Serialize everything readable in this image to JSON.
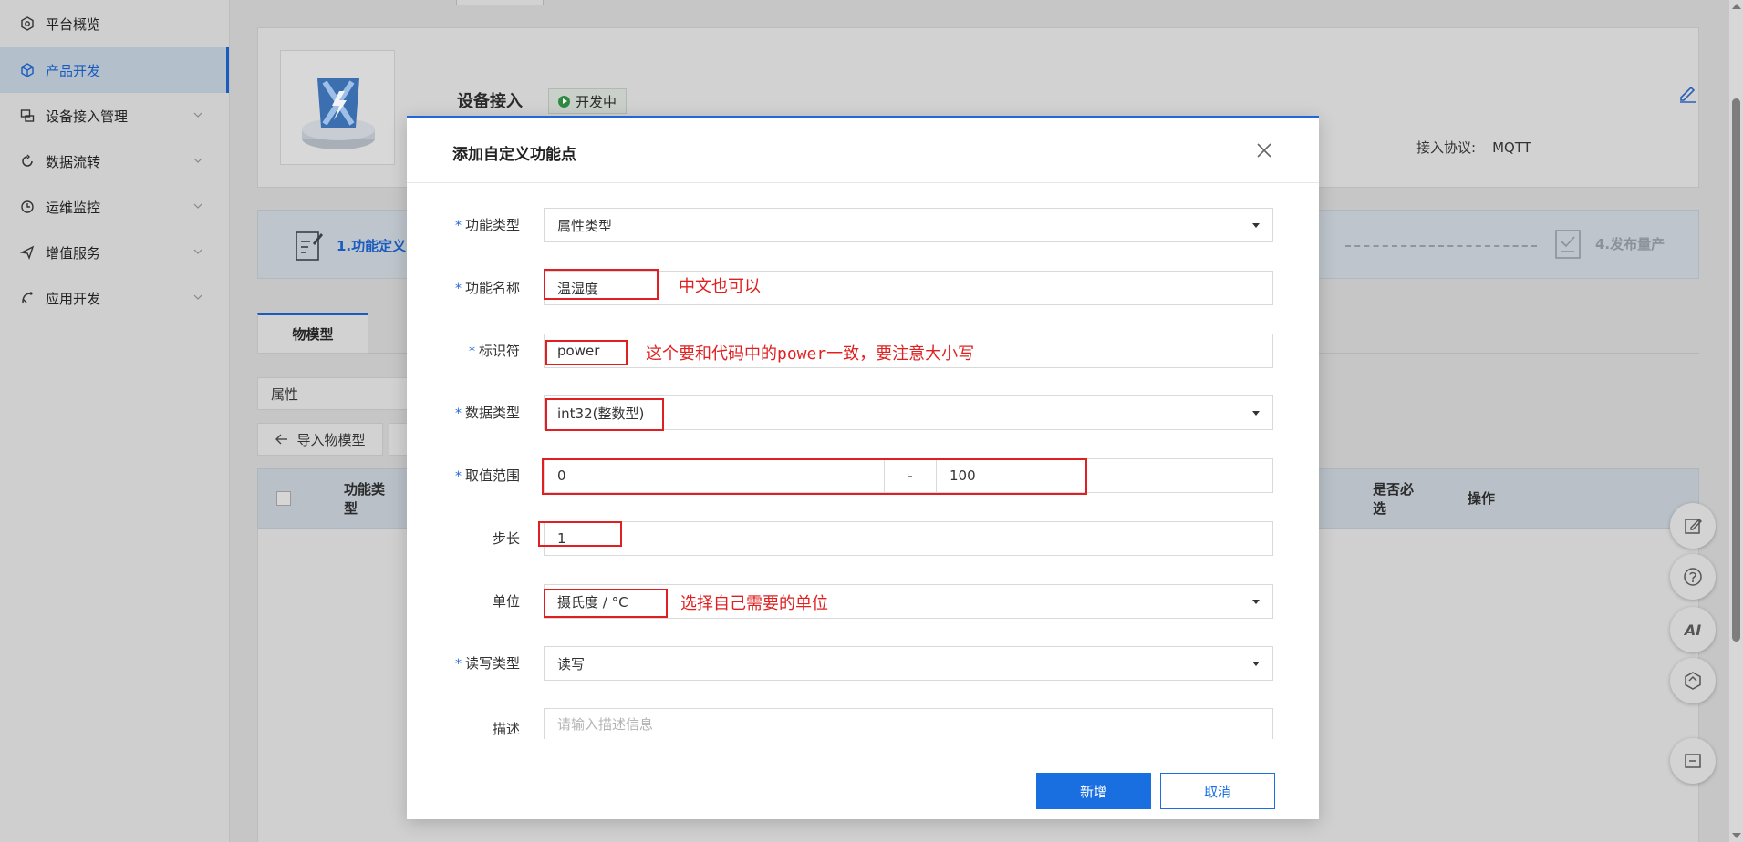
{
  "sidebar": {
    "items": [
      {
        "label": "平台概览",
        "icon": "platform-icon"
      },
      {
        "label": "产品开发",
        "icon": "cube-icon",
        "active": true
      },
      {
        "label": "设备接入管理",
        "icon": "device-icon"
      },
      {
        "label": "数据流转",
        "icon": "flow-icon"
      },
      {
        "label": "运维监控",
        "icon": "monitor-icon"
      },
      {
        "label": "增值服务",
        "icon": "service-icon"
      },
      {
        "label": "应用开发",
        "icon": "app-icon"
      }
    ]
  },
  "product": {
    "title": "设备接入",
    "status": "开发中",
    "protocol_label": "接入协议:",
    "protocol_value": "MQTT"
  },
  "steps": {
    "step1": "1.功能定义",
    "step4": "4.发布量产"
  },
  "tabs": {
    "model": "物模型"
  },
  "filter": {
    "type_select": "属性"
  },
  "toolbar": {
    "import_label": "导入物模型"
  },
  "table": {
    "headers": [
      "功能类型",
      "是否必选",
      "操作"
    ],
    "header_lines": {
      "type": [
        "功能类",
        "型"
      ],
      "required": [
        "是否必",
        "选"
      ],
      "action": "操作"
    }
  },
  "floating": {
    "ai_label": "AI"
  },
  "modal": {
    "title": "添加自定义功能点",
    "fields": {
      "func_type": {
        "label": "功能类型",
        "value": "属性类型"
      },
      "func_name": {
        "label": "功能名称",
        "value": "温湿度"
      },
      "identifier": {
        "label": "标识符",
        "value": "power"
      },
      "data_type": {
        "label": "数据类型",
        "value": "int32(整数型)"
      },
      "range": {
        "label": "取值范围",
        "min": "0",
        "sep": "-",
        "max": "100"
      },
      "step": {
        "label": "步长",
        "value": "1"
      },
      "unit": {
        "label": "单位",
        "value": "摄氏度 / °C"
      },
      "rw_type": {
        "label": "读写类型",
        "value": "读写"
      },
      "desc": {
        "label": "描述",
        "placeholder": "请输入描述信息"
      }
    },
    "annotations": {
      "name_note": "中文也可以",
      "identifier_note": "这个要和代码中的power一致，要注意大小写",
      "unit_note": "选择自己需要的单位"
    },
    "buttons": {
      "submit": "新增",
      "cancel": "取消"
    }
  },
  "colors": {
    "primary": "#1a6fe0",
    "annotation_red": "#e02020",
    "status_green": "#2f8a41"
  }
}
